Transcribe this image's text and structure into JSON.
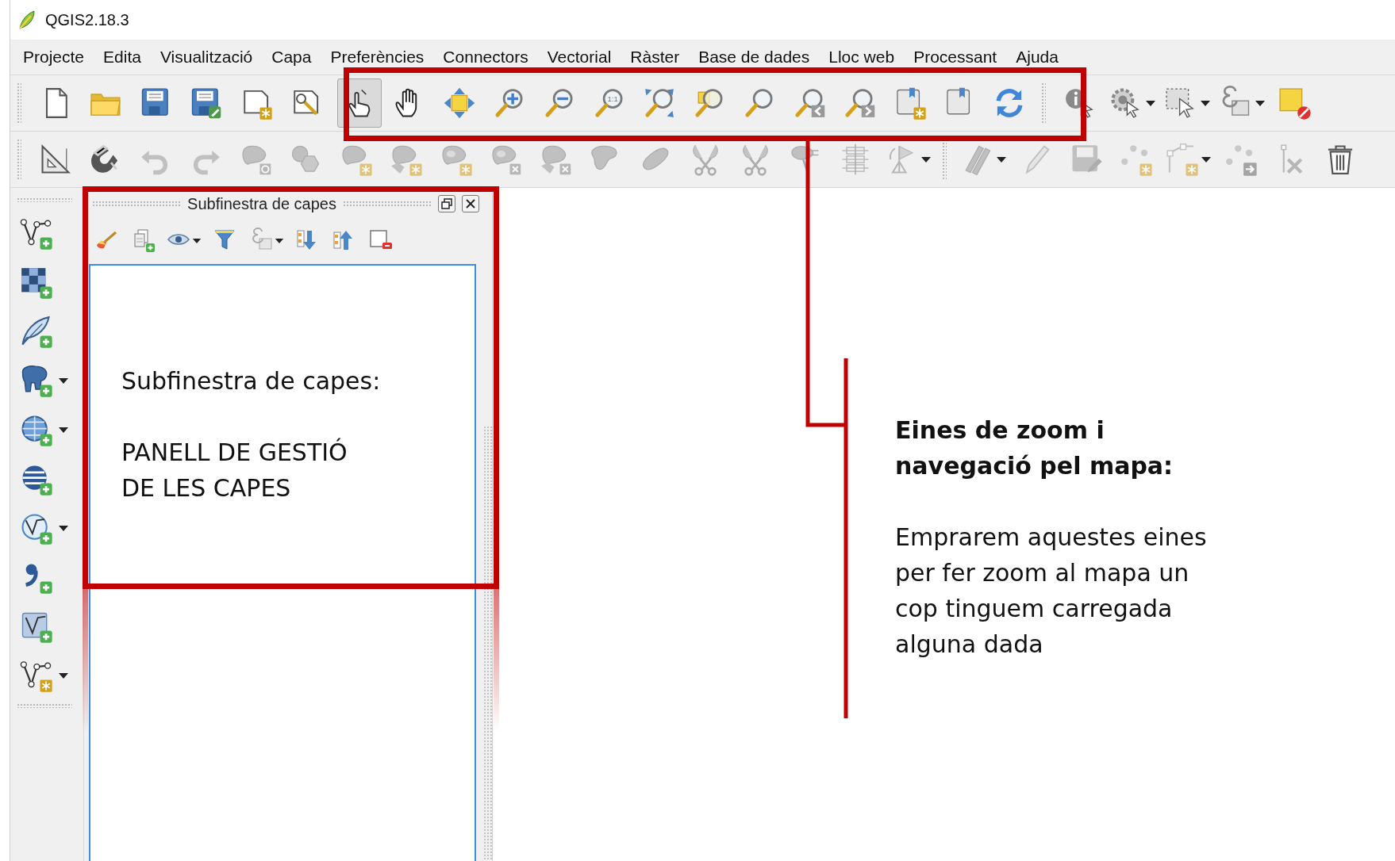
{
  "window": {
    "title": "QGIS2.18.3"
  },
  "menu_bar": [
    "Projecte",
    "Edita",
    "Visualització",
    "Capa",
    "Preferències",
    "Connectors",
    "Vectorial",
    "Ràster",
    "Base de dades",
    "Lloc web",
    "Processant",
    "Ajuda"
  ],
  "toolbar_rows": [
    [
      {
        "handle": true,
        "items": [
          {
            "kind": "file-new",
            "selected": false
          },
          {
            "kind": "folder-open",
            "selected": false
          },
          {
            "kind": "save",
            "selected": false
          },
          {
            "kind": "save-as",
            "selected": false
          },
          {
            "kind": "print-new",
            "selected": false
          },
          {
            "kind": "print-manager",
            "selected": false
          }
        ]
      },
      {
        "handle": false,
        "items": [
          {
            "kind": "pan-touch",
            "selected": true
          },
          {
            "kind": "pan-hand",
            "selected": false
          },
          {
            "kind": "pan-selection",
            "selected": false
          },
          {
            "kind": "zoom-in",
            "selected": false
          },
          {
            "kind": "zoom-out",
            "selected": false
          },
          {
            "kind": "zoom-native",
            "selected": false,
            "label": "1:1"
          },
          {
            "kind": "zoom-full",
            "selected": false
          },
          {
            "kind": "zoom-selection",
            "selected": false
          },
          {
            "kind": "zoom-layer",
            "selected": false
          },
          {
            "kind": "zoom-last",
            "selected": false
          },
          {
            "kind": "zoom-next",
            "selected": false
          },
          {
            "kind": "bookmark-new",
            "selected": false
          },
          {
            "kind": "bookmark-show",
            "selected": false
          },
          {
            "kind": "refresh",
            "selected": false
          }
        ]
      },
      {
        "handle": true,
        "items": [
          {
            "kind": "identify",
            "selected": false
          },
          {
            "kind": "action",
            "selected": false,
            "dropdown": true
          },
          {
            "kind": "select",
            "selected": false,
            "dropdown": true
          },
          {
            "kind": "select-expression",
            "selected": false,
            "dropdown": true
          },
          {
            "kind": "deselect",
            "selected": false
          }
        ]
      }
    ],
    [
      {
        "handle": true,
        "items": [
          {
            "kind": "measure",
            "disabled": false
          },
          {
            "kind": "magnet",
            "disabled": false
          },
          {
            "kind": "undo",
            "disabled": true
          },
          {
            "kind": "redo",
            "disabled": true
          },
          {
            "kind": "shape-rotate",
            "disabled": true
          },
          {
            "kind": "shape-simplify",
            "disabled": true
          },
          {
            "kind": "shape-add-ring",
            "disabled": true
          },
          {
            "kind": "shape-add-part",
            "disabled": true
          },
          {
            "kind": "shape-fill-ring",
            "disabled": true
          },
          {
            "kind": "shape-delete-ring",
            "disabled": true
          },
          {
            "kind": "shape-delete-part",
            "disabled": true
          },
          {
            "kind": "shape-reshape",
            "disabled": true
          },
          {
            "kind": "shape-offset",
            "disabled": true
          },
          {
            "kind": "scissors",
            "disabled": true
          },
          {
            "kind": "scissors",
            "disabled": true
          },
          {
            "kind": "pin",
            "disabled": true
          },
          {
            "kind": "align",
            "disabled": true
          },
          {
            "kind": "rotate-label",
            "disabled": true,
            "dropdown": true
          }
        ]
      },
      {
        "handle": true,
        "items": [
          {
            "kind": "pencils",
            "disabled": true,
            "dropdown": true
          },
          {
            "kind": "pencil",
            "disabled": true
          },
          {
            "kind": "save-edits",
            "disabled": true
          },
          {
            "kind": "points-add",
            "disabled": true
          },
          {
            "kind": "node-tool",
            "disabled": true,
            "dropdown": true
          },
          {
            "kind": "points-move",
            "disabled": true
          },
          {
            "kind": "delete-selected",
            "disabled": true
          },
          {
            "kind": "trash",
            "disabled": false
          }
        ]
      }
    ]
  ],
  "data_source_toolbar": [
    {
      "kind": "vertex-layer",
      "dropdown": false
    },
    {
      "kind": "checker-layer",
      "dropdown": false
    },
    {
      "kind": "feather-layer",
      "dropdown": false
    },
    {
      "kind": "elephant-layer",
      "dropdown": true
    },
    {
      "kind": "globe-layer",
      "dropdown": true
    },
    {
      "kind": "globe-grid-layer",
      "dropdown": false
    },
    {
      "kind": "globe-vertex-layer",
      "dropdown": true
    },
    {
      "kind": "comma-layer",
      "dropdown": false
    },
    {
      "kind": "polygon-layer",
      "dropdown": false
    },
    {
      "kind": "vertex-new-layer",
      "dropdown": true
    }
  ],
  "layers_panel": {
    "title": "Subfinestra de capes",
    "tools": [
      {
        "kind": "brush",
        "dropdown": false
      },
      {
        "kind": "add-group",
        "dropdown": false
      },
      {
        "kind": "eye",
        "dropdown": true
      },
      {
        "kind": "funnel",
        "dropdown": false
      },
      {
        "kind": "expression",
        "dropdown": true
      },
      {
        "kind": "expand",
        "dropdown": false
      },
      {
        "kind": "collapse",
        "dropdown": false
      },
      {
        "kind": "remove",
        "dropdown": false
      }
    ]
  },
  "annotations": [
    {
      "kind": "panel_note",
      "heading": "Subfinestra de capes:",
      "body": "PANELL DE GESTIÓ\nDE LES CAPES"
    },
    {
      "kind": "zoom_note",
      "heading": "Eines de zoom i\nnavegació pel mapa:",
      "body": "Emprarem aquestes eines\nper fer zoom al mapa un\ncop tinguem carregada\nalguna dada"
    }
  ]
}
